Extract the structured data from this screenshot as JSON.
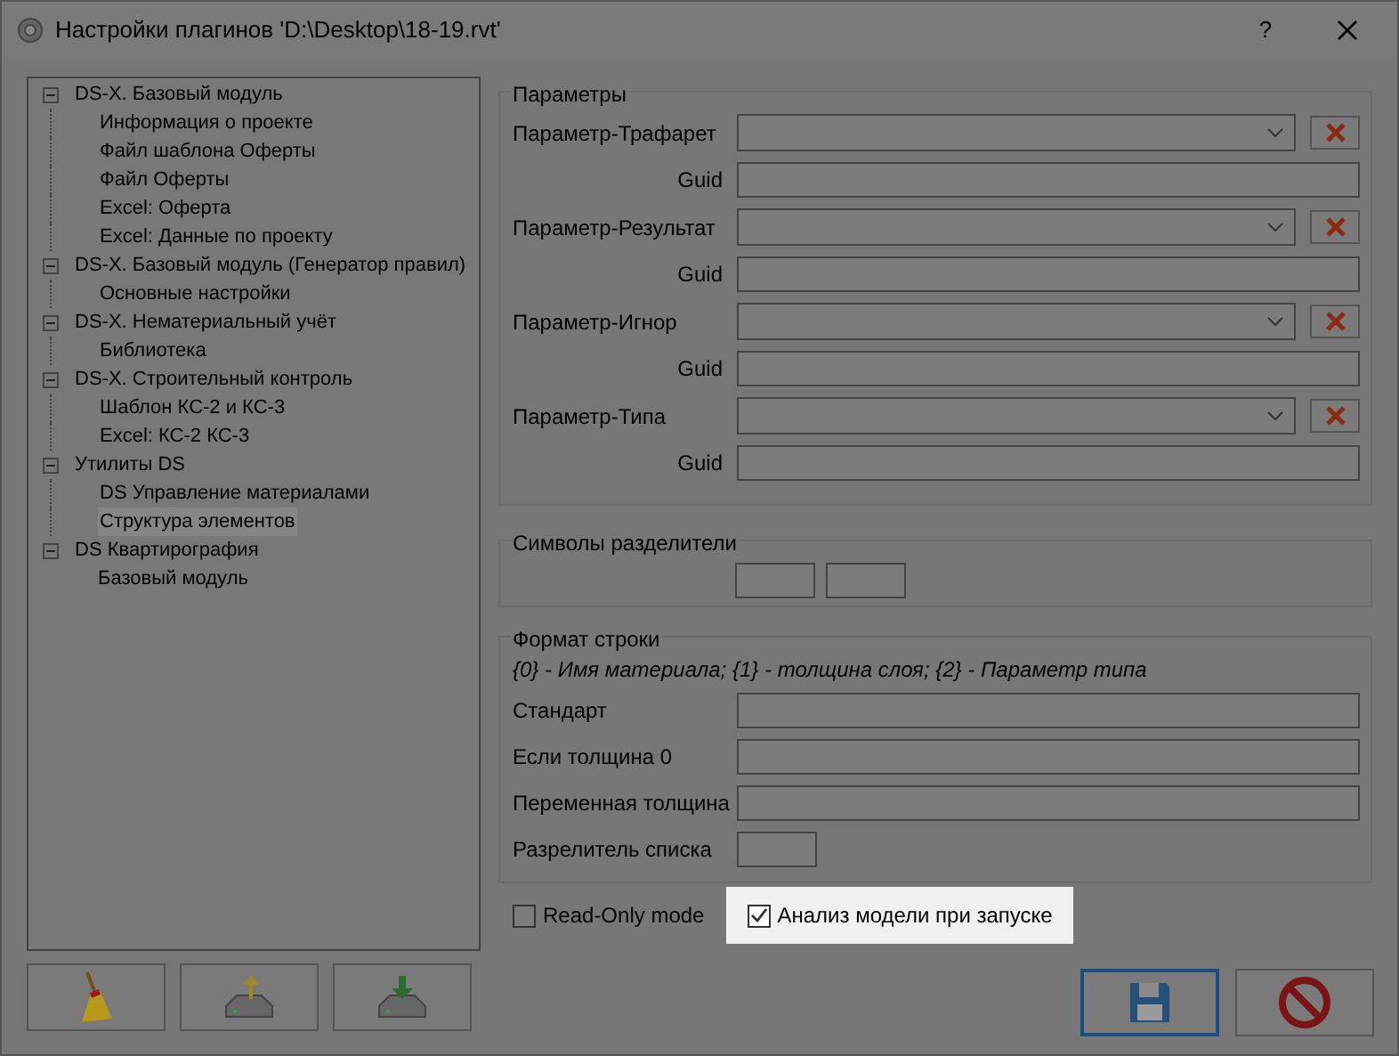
{
  "window": {
    "title": "Настройки плагинов 'D:\\Desktop\\18-19.rvt'",
    "help": "?"
  },
  "tree": [
    {
      "label": "DS-X. Базовый модуль",
      "expanded": true,
      "selected": false,
      "children": [
        {
          "label": "Информация о проекте",
          "selected": false
        },
        {
          "label": "Файл шаблона Оферты",
          "selected": false
        },
        {
          "label": "Файл Оферты",
          "selected": false
        },
        {
          "label": "Excel: Оферта",
          "selected": false
        },
        {
          "label": "Excel: Данные по проекту",
          "selected": false
        }
      ]
    },
    {
      "label": "DS-X. Базовый модуль (Генератор правил)",
      "expanded": true,
      "selected": false,
      "children": [
        {
          "label": "Основные настройки",
          "selected": false
        }
      ]
    },
    {
      "label": "DS-X. Нематериальный учёт",
      "expanded": true,
      "selected": false,
      "children": [
        {
          "label": "Библиотека",
          "selected": false
        }
      ]
    },
    {
      "label": "DS-X. Строительный контроль",
      "expanded": true,
      "selected": false,
      "children": [
        {
          "label": "Шаблон КС-2 и КС-3",
          "selected": false
        },
        {
          "label": "Excel: КС-2 КС-3",
          "selected": false
        }
      ]
    },
    {
      "label": "Утилиты DS",
      "expanded": true,
      "selected": false,
      "children": [
        {
          "label": "DS Управление материалами",
          "selected": false
        },
        {
          "label": "Структура элементов",
          "selected": true
        }
      ]
    },
    {
      "label": "DS Квартирография",
      "expanded": true,
      "selected": false,
      "children": [
        {
          "label": "Базовый модуль",
          "selected": false
        }
      ]
    }
  ],
  "parameters": {
    "title": "Параметры",
    "rows": [
      {
        "label": "Параметр-Трафарет",
        "guid_label": "Guid"
      },
      {
        "label": "Параметр-Результат",
        "guid_label": "Guid"
      },
      {
        "label": "Параметр-Игнор",
        "guid_label": "Guid"
      },
      {
        "label": "Параметр-Типа",
        "guid_label": "Guid"
      }
    ]
  },
  "separators": {
    "title": "Символы разделители"
  },
  "format": {
    "title": "Формат строки",
    "hint": "{0} - Имя материала; {1} - толщина слоя; {2} - Параметр типа",
    "fields": [
      {
        "label": "Стандарт",
        "kind": "wide"
      },
      {
        "label": "Если толщина 0",
        "kind": "wide"
      },
      {
        "label": "Переменная толщина",
        "kind": "wide"
      },
      {
        "label": "Разрелитель списка",
        "kind": "small"
      }
    ]
  },
  "checkboxes": [
    {
      "label": "Read-Only mode",
      "checked": false,
      "highlighted": false
    },
    {
      "label": "Анализ модели при запуске",
      "checked": true,
      "highlighted": true
    }
  ],
  "save_button": {
    "focused": true
  }
}
